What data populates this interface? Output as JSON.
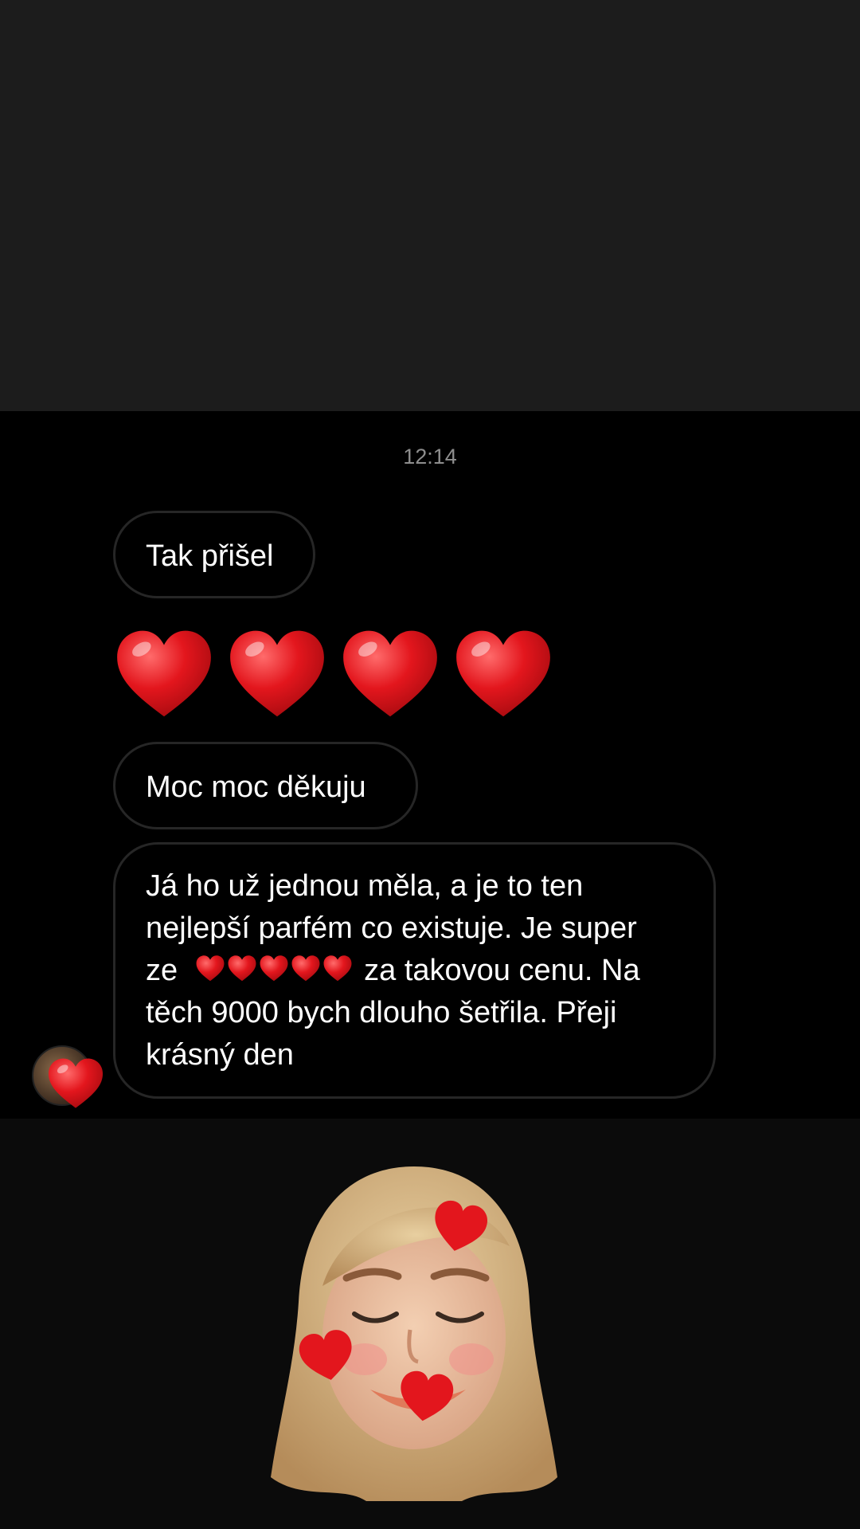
{
  "chat": {
    "timestamp": "12:14",
    "messages": [
      {
        "text": "Tak přišel"
      },
      {
        "type": "emoji",
        "emoji": "heart",
        "count": 4
      },
      {
        "text": "Moc moc děkuju"
      },
      {
        "line1": "Já ho už jednou měla, a je to ten",
        "line2": "nejlepší parfém co existuje. Je super",
        "line3_pre": "ze",
        "line3_post": "za takovou cenu. Na",
        "line4": "těch 9000 bych dlouho šetřila. Přeji",
        "line5": "krásný den",
        "inline_hearts": 5
      }
    ],
    "reaction": "heart"
  },
  "colors": {
    "top_background": "#1c1c1c",
    "chat_background": "#000000",
    "bubble_border": "#262626",
    "heart": "#e3161d",
    "timestamp": "#8e8e8e"
  },
  "sticker": {
    "icon": "memoji-with-hearts-icon"
  }
}
